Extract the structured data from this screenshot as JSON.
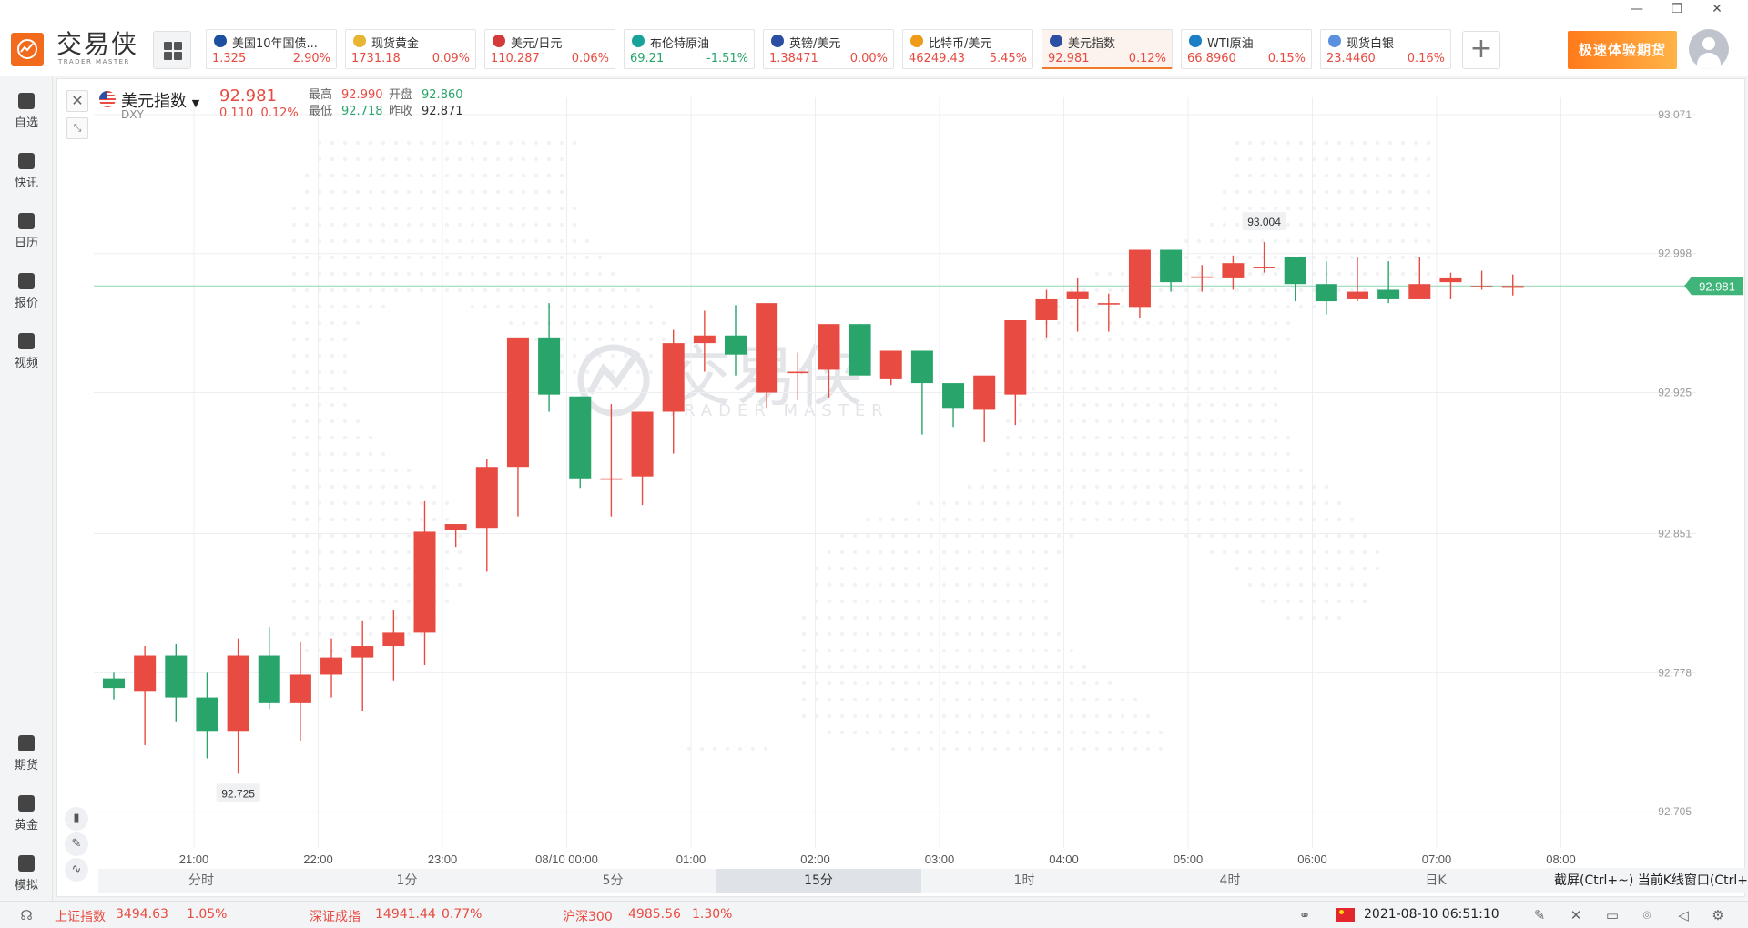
{
  "app": {
    "brand_cn": "交易侠",
    "brand_en": "TRADER MASTER",
    "promo_label": "极速体验期货",
    "window_controls": [
      "—",
      "❐",
      "✕"
    ]
  },
  "tickers": [
    {
      "name": "美国10年国债...",
      "price": "1.325",
      "change": "2.90%",
      "dir": "up",
      "icon_color": "#1d4fa0",
      "active": false
    },
    {
      "name": "现货黄金",
      "price": "1731.18",
      "change": "0.09%",
      "dir": "up",
      "icon_color": "#e8b434",
      "active": false
    },
    {
      "name": "美元/日元",
      "price": "110.287",
      "change": "0.06%",
      "dir": "up",
      "icon_color": "#d33a3a",
      "active": false
    },
    {
      "name": "布伦特原油",
      "price": "69.21",
      "change": "-1.51%",
      "dir": "down",
      "icon_color": "#18a39a",
      "active": false
    },
    {
      "name": "英镑/美元",
      "price": "1.38471",
      "change": "0.00%",
      "dir": "up",
      "icon_color": "#2c4fa3",
      "active": false
    },
    {
      "name": "比特币/美元",
      "price": "46249.43",
      "change": "5.45%",
      "dir": "up",
      "icon_color": "#f09a1a",
      "active": false
    },
    {
      "name": "美元指数",
      "price": "92.981",
      "change": "0.12%",
      "dir": "up",
      "icon_color": "#2c4fa3",
      "active": true
    },
    {
      "name": "WTI原油",
      "price": "66.8960",
      "change": "0.15%",
      "dir": "up",
      "icon_color": "#1a7fc4",
      "active": false
    },
    {
      "name": "现货白银",
      "price": "23.4460",
      "change": "0.16%",
      "dir": "up",
      "icon_color": "#5b8fe0",
      "active": false
    }
  ],
  "sidebar": {
    "top": [
      {
        "label": "自选",
        "icon": "bookmark-icon"
      },
      {
        "label": "快讯",
        "icon": "news-icon"
      },
      {
        "label": "日历",
        "icon": "calendar-icon"
      },
      {
        "label": "报价",
        "icon": "quote-icon"
      },
      {
        "label": "视频",
        "icon": "video-icon"
      }
    ],
    "bottom": [
      {
        "label": "期货",
        "icon": "futures-icon"
      },
      {
        "label": "黄金",
        "icon": "gold-icon"
      },
      {
        "label": "模拟",
        "icon": "simulate-icon"
      }
    ]
  },
  "symbol": {
    "name": "美元指数",
    "code": "DXY",
    "price": "92.981",
    "change": "0.110",
    "change_pct": "0.12%",
    "high_label": "最高",
    "high": "92.990",
    "open_label": "开盘",
    "open": "92.860",
    "low_label": "最低",
    "low": "92.718",
    "prev_label": "昨收",
    "prev": "92.871"
  },
  "watermark": {
    "cn": "交易侠",
    "en": "TRADER MASTER"
  },
  "chart_data": {
    "type": "candlestick",
    "interval": "15分",
    "x_labels": [
      "21:00",
      "22:00",
      "23:00",
      "08/10 00:00",
      "01:00",
      "02:00",
      "03:00",
      "04:00",
      "05:00",
      "06:00",
      "07:00",
      "08:00"
    ],
    "y_ticks": [
      "93.071",
      "92.998",
      "92.925",
      "92.851",
      "92.778",
      "92.705"
    ],
    "ylim": [
      92.686,
      93.08
    ],
    "current_price_label": "92.981",
    "current_price": 92.981,
    "max_label": "93.004",
    "min_label": "92.725",
    "grid": true,
    "candles": [
      [
        92.775,
        92.778,
        92.764,
        92.77
      ],
      [
        92.768,
        92.792,
        92.74,
        92.787
      ],
      [
        92.787,
        92.793,
        92.752,
        92.765
      ],
      [
        92.765,
        92.778,
        92.733,
        92.747
      ],
      [
        92.747,
        92.796,
        92.725,
        92.787
      ],
      [
        92.787,
        92.802,
        92.759,
        92.762
      ],
      [
        92.762,
        92.794,
        92.742,
        92.777
      ],
      [
        92.777,
        92.796,
        92.765,
        92.786
      ],
      [
        92.786,
        92.805,
        92.758,
        92.792
      ],
      [
        92.792,
        92.811,
        92.774,
        92.799
      ],
      [
        92.799,
        92.868,
        92.782,
        92.852
      ],
      [
        92.853,
        92.855,
        92.844,
        92.856
      ],
      [
        92.854,
        92.89,
        92.831,
        92.886
      ],
      [
        92.886,
        92.944,
        92.86,
        92.954
      ],
      [
        92.954,
        92.972,
        92.915,
        92.924
      ],
      [
        92.923,
        92.923,
        92.875,
        92.88
      ],
      [
        92.88,
        92.919,
        92.86,
        92.88
      ],
      [
        92.881,
        92.914,
        92.866,
        92.915
      ],
      [
        92.915,
        92.958,
        92.893,
        92.951
      ],
      [
        92.951,
        92.968,
        92.936,
        92.955
      ],
      [
        92.955,
        92.971,
        92.934,
        92.945
      ],
      [
        92.925,
        92.964,
        92.917,
        92.972
      ],
      [
        92.936,
        92.946,
        92.921,
        92.936
      ],
      [
        92.937,
        92.959,
        92.922,
        92.961
      ],
      [
        92.961,
        92.961,
        92.943,
        92.934
      ],
      [
        92.932,
        92.94,
        92.929,
        92.947
      ],
      [
        92.947,
        92.938,
        92.903,
        92.93
      ],
      [
        92.93,
        92.927,
        92.907,
        92.917
      ],
      [
        92.916,
        92.916,
        92.899,
        92.934
      ],
      [
        92.924,
        92.928,
        92.908,
        92.963
      ],
      [
        92.963,
        92.979,
        92.954,
        92.974
      ],
      [
        92.974,
        92.985,
        92.957,
        92.978
      ],
      [
        92.972,
        92.977,
        92.957,
        92.972
      ],
      [
        92.97,
        93.0,
        92.964,
        93.0
      ],
      [
        93.0,
        92.998,
        92.978,
        92.983
      ],
      [
        92.986,
        92.992,
        92.978,
        92.986
      ],
      [
        92.985,
        92.997,
        92.979,
        92.993
      ],
      [
        92.991,
        93.004,
        92.988,
        92.991
      ],
      [
        92.996,
        92.996,
        92.973,
        92.982
      ],
      [
        92.982,
        92.994,
        92.966,
        92.973
      ],
      [
        92.974,
        92.996,
        92.973,
        92.978
      ],
      [
        92.979,
        92.994,
        92.972,
        92.974
      ],
      [
        92.974,
        92.996,
        92.974,
        92.982
      ],
      [
        92.983,
        92.988,
        92.974,
        92.985
      ],
      [
        92.981,
        92.989,
        92.979,
        92.981
      ],
      [
        92.98,
        92.987,
        92.976,
        92.981
      ]
    ]
  },
  "timeframes": [
    {
      "label": "分时",
      "active": false
    },
    {
      "label": "1分",
      "active": false
    },
    {
      "label": "5分",
      "active": false
    },
    {
      "label": "15分",
      "active": true
    },
    {
      "label": "1时",
      "active": false
    },
    {
      "label": "4时",
      "active": false
    },
    {
      "label": "日K",
      "active": false
    }
  ],
  "shot_tip": "截屏(Ctrl+~) 当前K线窗口(Ctrl+P)",
  "status": {
    "idx1_name": "上证指数",
    "idx1_value": "3494.63",
    "idx1_change": "1.05%",
    "idx2_name": "深证成指",
    "idx2_value": "14941.44",
    "idx2_change": "0.77%",
    "idx3_name": "沪深300",
    "idx3_value": "4985.56",
    "idx3_change": "1.30%",
    "datetime": "2021-08-10 06:51:10"
  },
  "colors": {
    "up": "#e84b41",
    "down": "#29a56b",
    "accent": "#f26b1d"
  }
}
